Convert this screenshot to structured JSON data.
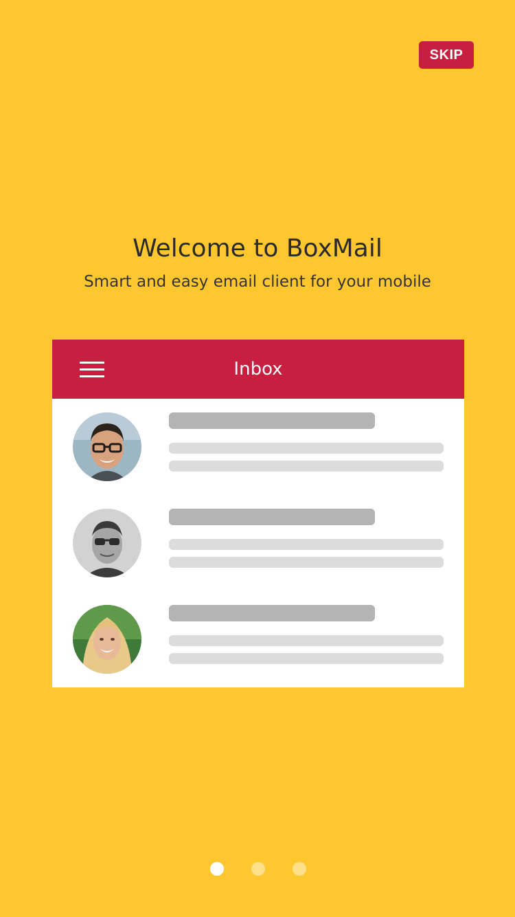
{
  "skip_label": "SKIP",
  "welcome": {
    "title": "Welcome to BoxMail",
    "subtitle": "Smart and easy email client for your mobile"
  },
  "inbox_card": {
    "header_title": "Inbox",
    "menu_icon": "hamburger-menu-icon",
    "items": [
      {
        "avatar": "avatar-man-glasses-color"
      },
      {
        "avatar": "avatar-man-glasses-grayscale"
      },
      {
        "avatar": "avatar-woman-blonde"
      }
    ]
  },
  "pagination": {
    "total": 3,
    "active_index": 0
  },
  "colors": {
    "background": "#FFC72F",
    "accent": "#C81E40",
    "card": "#FFFFFF",
    "placeholder_dark": "#B4B4B4",
    "placeholder_light": "#DCDCDC",
    "dot_active": "#FFFFFF",
    "dot_inactive": "#FFE08A"
  }
}
